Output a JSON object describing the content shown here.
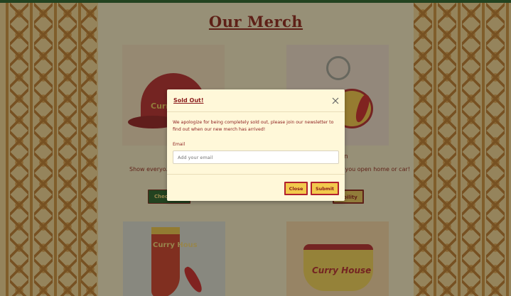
{
  "page": {
    "title": "Our Merch"
  },
  "products": [
    {
      "id": "cap",
      "image_text": "Curry",
      "description": "Show everyo... to curry ar...",
      "button_label": "Check"
    },
    {
      "id": "keychain",
      "name": "ain",
      "description": "ime you open home or car!",
      "button_label": "ability"
    },
    {
      "id": "sock",
      "image_text": "Curry Hous"
    },
    {
      "id": "boxer",
      "image_text": "Curry House"
    }
  ],
  "modal": {
    "title": "Sold Out!",
    "message": "We apologize for being completely sold out, please join our newsletter to find out when our new merch has arrived!",
    "email_label": "Email",
    "email_placeholder": "Add your email",
    "close_label": "Close",
    "submit_label": "Submit",
    "close_icon": "close-icon"
  },
  "colors": {
    "brand_red": "#8a1b1b",
    "accent_yellow": "#f2c94c",
    "dark_green": "#1f5a2a"
  }
}
